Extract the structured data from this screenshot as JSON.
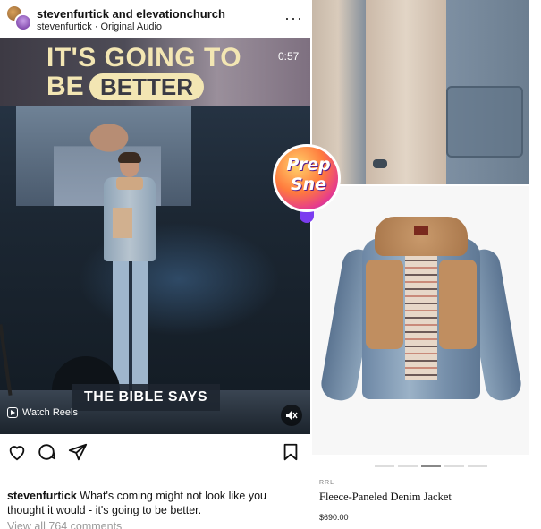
{
  "post": {
    "author": "stevenfurtick and elevationchurch",
    "audio": "stevenfurtick · Original Audio",
    "more": "···",
    "video": {
      "headline_line1": "IT'S GOING TO",
      "headline_be": "BE",
      "headline_pill": "BETTER",
      "timer": "0:57",
      "caption_bar": "THE BIBLE SAYS",
      "watch_reels": "Watch Reels"
    },
    "caption_user": "stevenfurtick",
    "caption_text": " What's coming might not look like you thought it would - it's going to be better.",
    "view_comments": "View all 764 comments"
  },
  "badge": {
    "line1": "Prep",
    "line2": "Sne"
  },
  "product": {
    "brand": "RRL",
    "name": "Fleece-Paneled Denim Jacket",
    "price": "$690.00",
    "carousel_index": 3,
    "carousel_count": 5
  },
  "icons": {
    "heart": "heart-icon",
    "comment": "comment-icon",
    "share": "share-icon",
    "save": "bookmark-icon",
    "mute": "mute-icon",
    "reels": "reels-icon"
  }
}
